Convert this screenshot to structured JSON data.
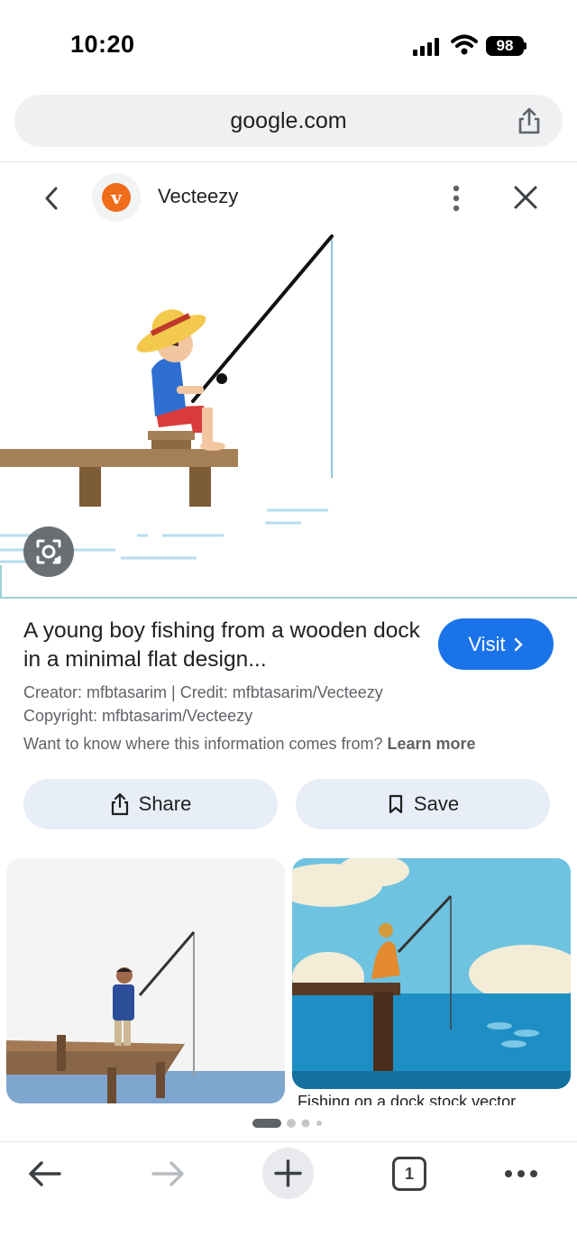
{
  "status": {
    "time": "10:20",
    "battery": "98"
  },
  "browser": {
    "url": "google.com"
  },
  "panel": {
    "source_name": "Vecteezy",
    "logo_letter": "v",
    "title": "A young boy fishing from a wooden dock in a minimal flat design...",
    "visit_label": "Visit",
    "creator_line": "Creator: mfbtasarim | Credit: mfbtasarim/Vecteezy",
    "copyright_line": "Copyright: mfbtasarim/Vecteezy",
    "info_question": "Want to know where this information comes from?",
    "learn_more": "Learn more",
    "share_label": "Share",
    "save_label": "Save"
  },
  "related": {
    "caption_2": "Fishing on a dock stock vector"
  },
  "toolbar": {
    "tab_count": "1"
  },
  "colors": {
    "accent": "#1a73e8",
    "logo": "#ef6c1a"
  },
  "icons": [
    "back-icon",
    "forward-icon",
    "new-tab-icon",
    "tabs-icon",
    "more-icon",
    "share-icon",
    "save-icon",
    "lens-icon",
    "close-icon",
    "kebab-icon",
    "chevron-left-icon"
  ]
}
